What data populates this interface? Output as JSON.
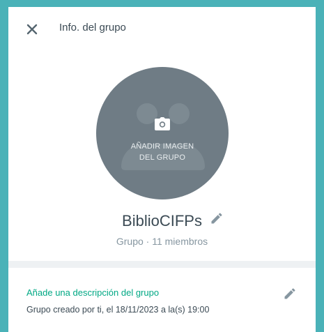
{
  "header": {
    "title": "Info. del grupo",
    "close_icon": "close-icon"
  },
  "avatar": {
    "label": "AÑADIR IMAGEN\nDEL GRUPO",
    "icon": "camera-icon"
  },
  "group": {
    "name": "BiblioCIFPs",
    "meta": "Grupo · 11 miembros",
    "edit_icon": "pencil-icon"
  },
  "description": {
    "add_label": "Añade una descripción del grupo",
    "created": "Grupo creado por ti, el 18/11/2023 a la(s) 19:00",
    "edit_icon": "pencil-icon"
  },
  "colors": {
    "background": "#4ab2b8",
    "accent": "#00a884",
    "avatar": "#6f7c85"
  }
}
